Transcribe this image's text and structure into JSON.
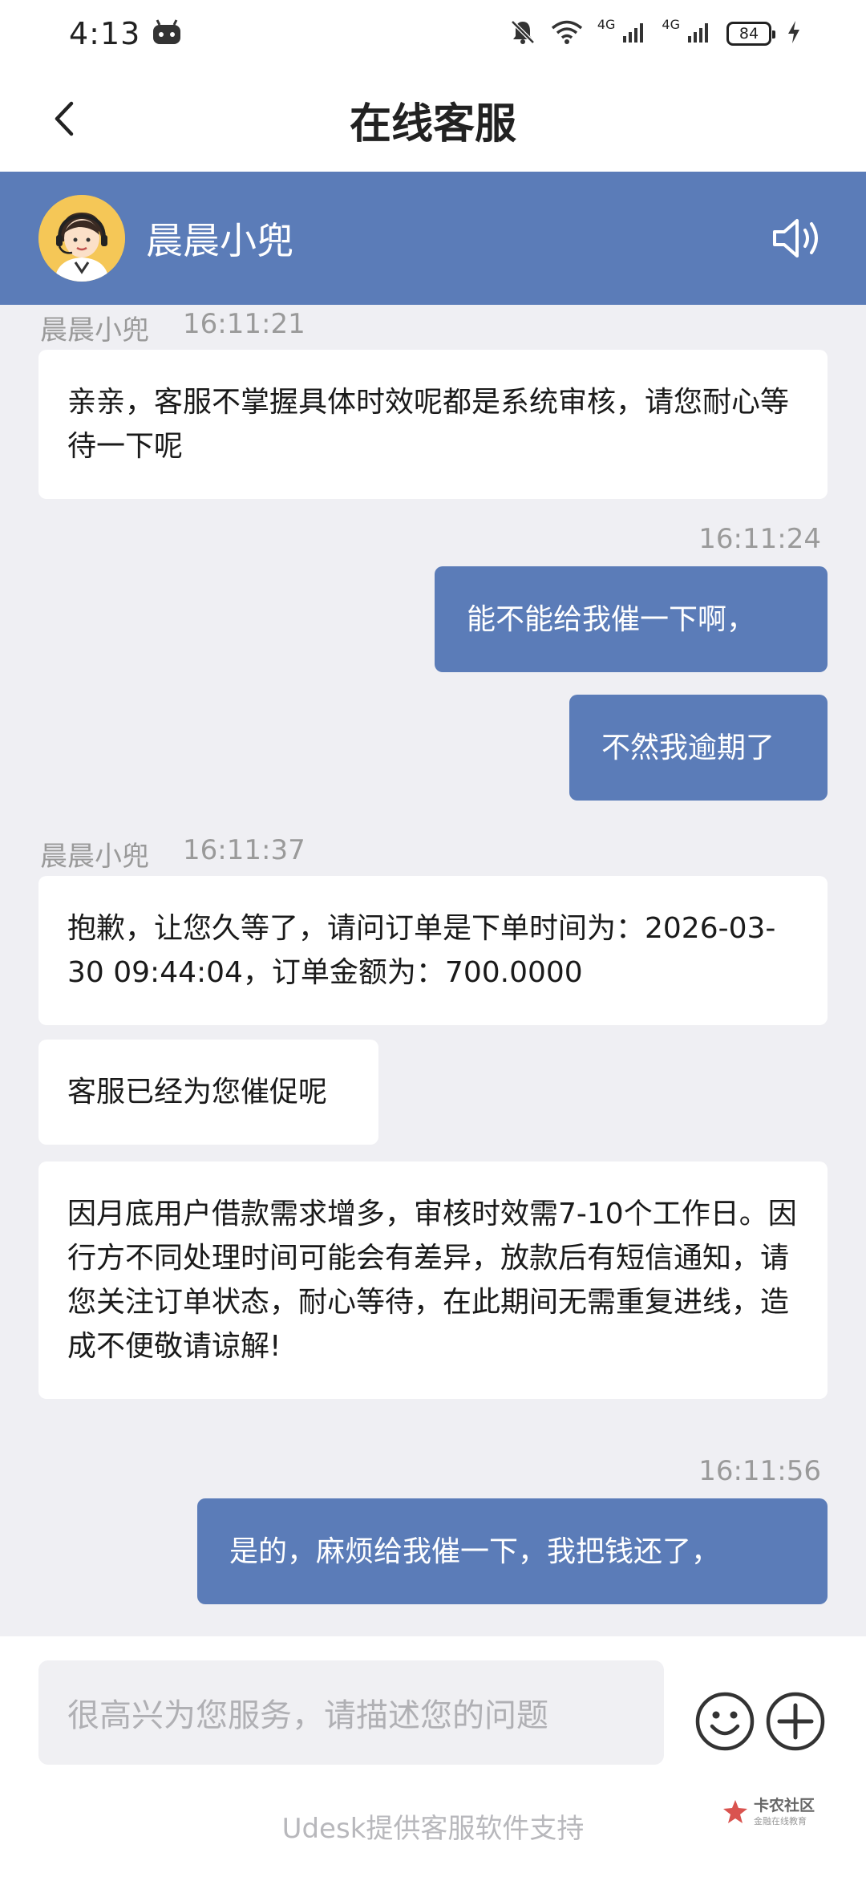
{
  "status_bar": {
    "time": "4:13",
    "net1": "4G",
    "net2": "4G",
    "battery": "84"
  },
  "nav": {
    "title": "在线客服"
  },
  "agent": {
    "name": "晨晨小兜"
  },
  "messages": [
    {
      "from": "agent",
      "sender": "晨晨小兜",
      "time": "16:11:21",
      "text": "亲亲，客服不掌握具体时效呢都是系统审核，请您耐心等待一下呢"
    },
    {
      "from": "user",
      "time": "16:11:24",
      "text": "能不能给我催一下啊，"
    },
    {
      "from": "user",
      "text": "不然我逾期了"
    },
    {
      "from": "agent",
      "sender": "晨晨小兜",
      "time": "16:11:37",
      "text": "抱歉，让您久等了，请问订单是下单时间为：2026-03-30 09:44:04，订单金额为：700.0000"
    },
    {
      "from": "agent",
      "text": "客服已经为您催促呢"
    },
    {
      "from": "agent",
      "text": "因月底用户借款需求增多，审核时效需7-10个工作日。因行方不同处理时间可能会有差异，放款后有短信通知，请您关注订单状态，耐心等待，在此期间无需重复进线，造成不便敬请谅解!"
    },
    {
      "from": "user",
      "time": "16:11:56",
      "text": "是的，麻烦给我催一下，我把钱还了，"
    }
  ],
  "composer": {
    "placeholder": "很高兴为您服务，请描述您的问题",
    "footer": "Udesk提供客服软件支持"
  },
  "watermark": {
    "main": "卡农社区",
    "sub": "金融在线教育"
  },
  "colors": {
    "accent": "#5b7cb8",
    "background": "#efeff3"
  },
  "icons": [
    "back-arrow-icon",
    "speaker-icon",
    "emoji-icon",
    "plus-icon",
    "mute-bell-icon",
    "wifi-icon",
    "signal-icon",
    "charging-icon"
  ]
}
